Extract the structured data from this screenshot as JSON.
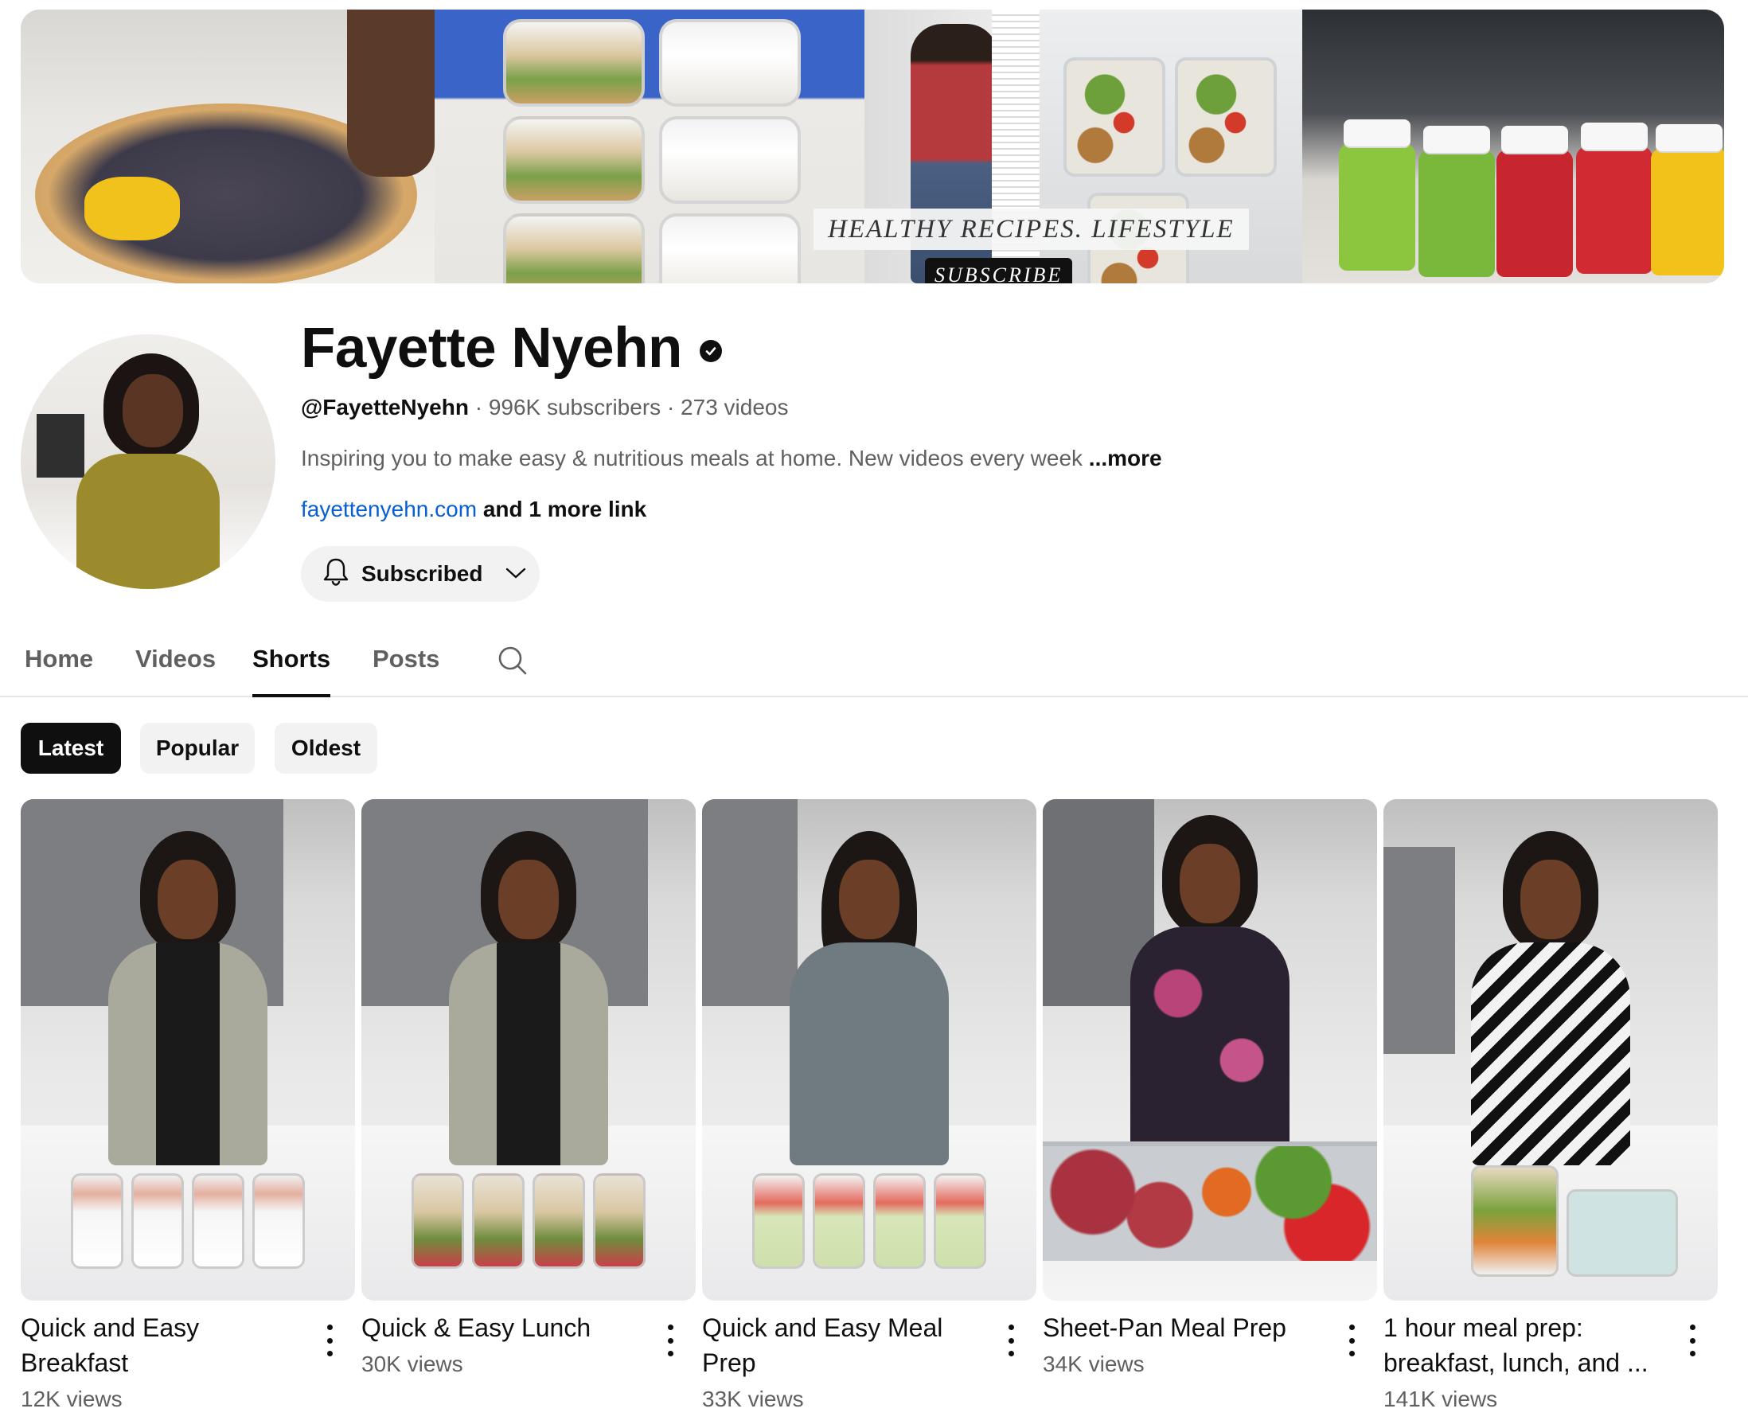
{
  "banner": {
    "tagline": "HEALTHY RECIPES. LIFESTYLE",
    "subscribe_text": "SUBSCRIBE"
  },
  "channel": {
    "name": "Fayette Nyehn",
    "handle": "@FayetteNyehn",
    "subscribers": "996K subscribers",
    "videos": "273 videos",
    "separator": "·",
    "description": "Inspiring you to make easy & nutritious meals at home. New videos every week",
    "more_label": "...more",
    "link": "fayettenyehn.com",
    "more_links": "and 1 more link",
    "subscribe_state": "Subscribed"
  },
  "tabs": [
    {
      "label": "Home",
      "active": false
    },
    {
      "label": "Videos",
      "active": false
    },
    {
      "label": "Shorts",
      "active": true
    },
    {
      "label": "Posts",
      "active": false
    }
  ],
  "chips": [
    {
      "label": "Latest",
      "active": true
    },
    {
      "label": "Popular",
      "active": false
    },
    {
      "label": "Oldest",
      "active": false
    }
  ],
  "shorts": [
    {
      "title": "Quick and Easy Breakfast",
      "views": "12K views"
    },
    {
      "title": "Quick & Easy Lunch",
      "views": "30K views"
    },
    {
      "title": "Quick and Easy Meal Prep",
      "views": "33K views"
    },
    {
      "title": "Sheet-Pan Meal Prep",
      "views": "34K views"
    },
    {
      "title": "1 hour meal prep: breakfast, lunch, and ...",
      "views": "141K views"
    }
  ],
  "icons": {
    "verified": "verified-check-icon",
    "bell": "bell-icon",
    "chevron": "chevron-down-icon",
    "search": "search-icon",
    "more": "more-vert-icon"
  },
  "colors": {
    "link": "#065fd4",
    "text_primary": "#0f0f0f",
    "text_secondary": "#606060",
    "chip_bg": "#f2f2f2",
    "chip_active_bg": "#0f0f0f"
  }
}
